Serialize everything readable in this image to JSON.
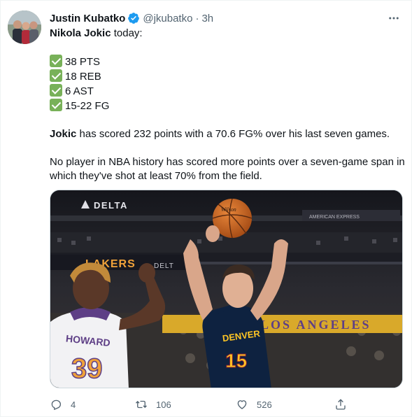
{
  "author": {
    "display_name": "Justin Kubatko",
    "handle": "@jkubatko",
    "separator": "·",
    "time": "3h",
    "verified": true
  },
  "tweet": {
    "intro_bold": "Nikola Jokic",
    "intro_rest": " today:",
    "stats": [
      "38 PTS",
      "18 REB",
      "6 AST",
      "15-22 FG"
    ],
    "para1_bold": "Jokic",
    "para1_rest": " has scored 232 points with a 70.6 FG% over his last seven games.",
    "para2_line1": "No player in NBA history has scored more points over a seven-game span in",
    "para2_line2": "which they've shot at least 70% from the field."
  },
  "media": {
    "arena_signs": [
      "DELTA",
      "LAKERS",
      "DELT",
      "AMERICAN EXPRESS",
      "LOS ANGELES"
    ],
    "player1": {
      "jersey_name": "HOWARD",
      "jersey_number": "39"
    },
    "player2": {
      "jersey_team": "DENVER",
      "jersey_number": "15"
    },
    "ball_brand": "Wilson"
  },
  "actions": {
    "reply_count": "4",
    "retweet_count": "106",
    "like_count": "526"
  },
  "icons": {
    "verified": "verified-badge-icon",
    "more": "more-options-icon",
    "reply": "reply-icon",
    "retweet": "retweet-icon",
    "like": "like-icon",
    "share": "share-icon"
  },
  "colors": {
    "accent": "#1d9bf0",
    "text": "#0f1419",
    "muted": "#536471",
    "check": "#78b159"
  }
}
